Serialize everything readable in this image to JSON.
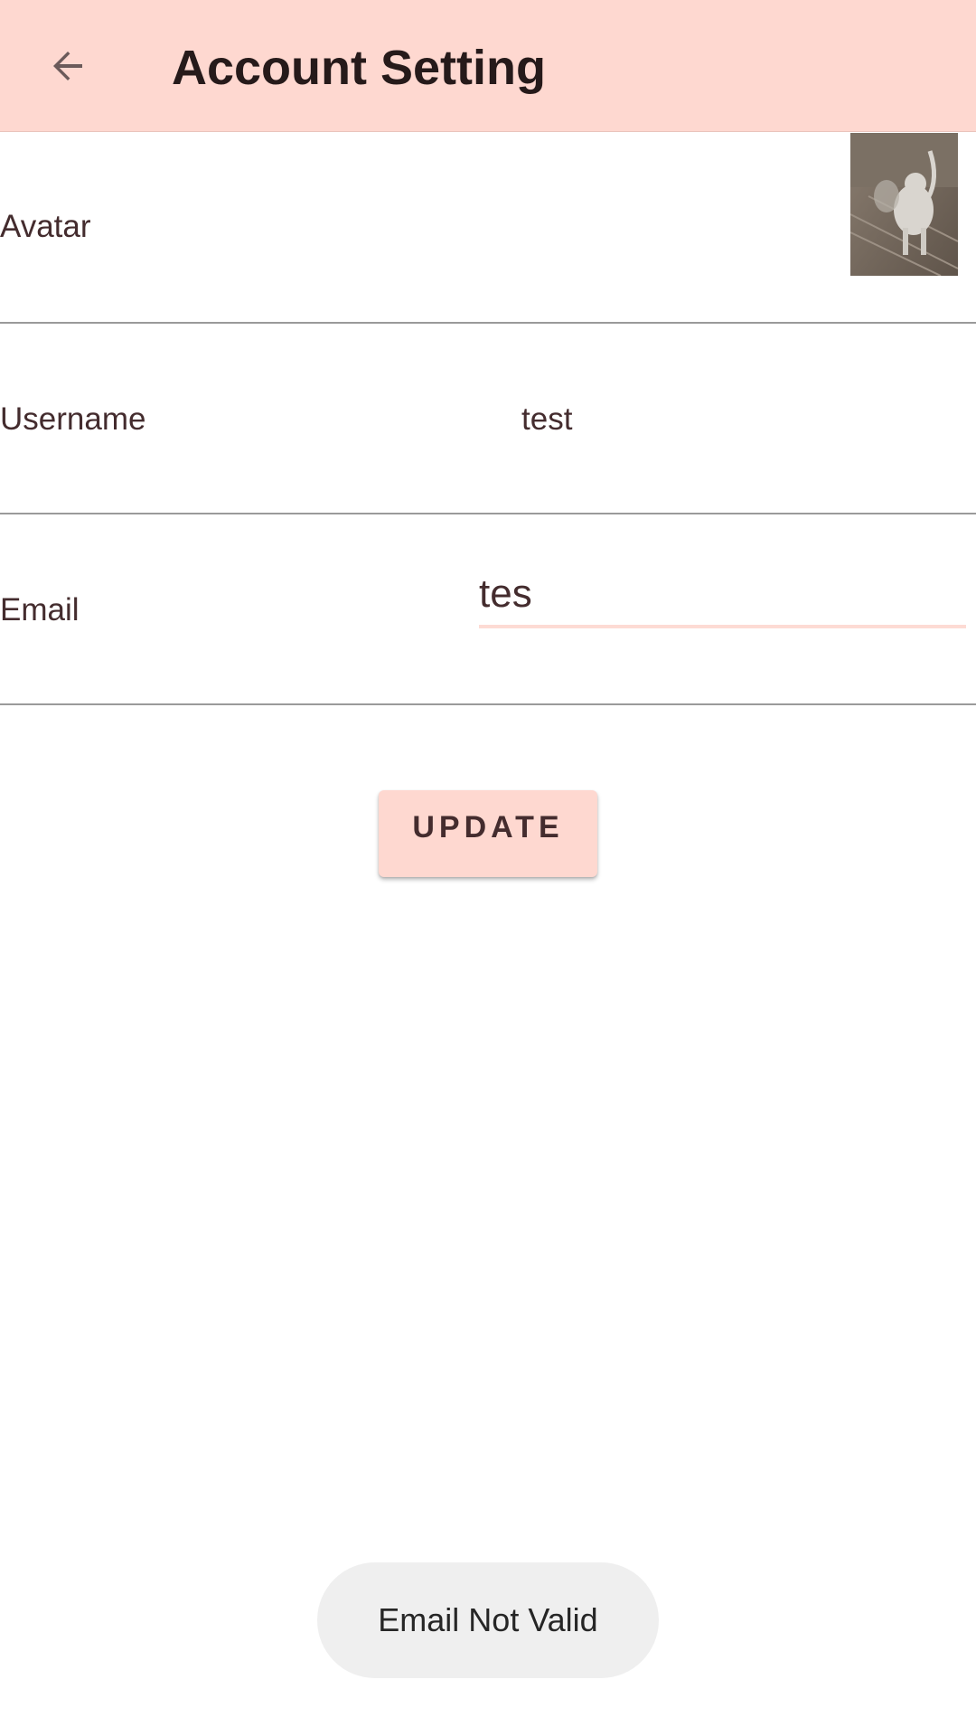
{
  "app_bar": {
    "title": "Account Setting",
    "back_icon": "arrow-back-icon"
  },
  "rows": {
    "avatar": {
      "label": "Avatar"
    },
    "username": {
      "label": "Username",
      "value": "test"
    },
    "email": {
      "label": "Email",
      "value": "tes",
      "placeholder": ""
    }
  },
  "update_button": {
    "label": "UPDATE"
  },
  "toast": {
    "message": "Email Not Valid"
  },
  "colors": {
    "primary": "#fed8d0",
    "on_primary": "#442c2e",
    "divider": "#9a9a9a",
    "toast_bg": "#efefef"
  }
}
